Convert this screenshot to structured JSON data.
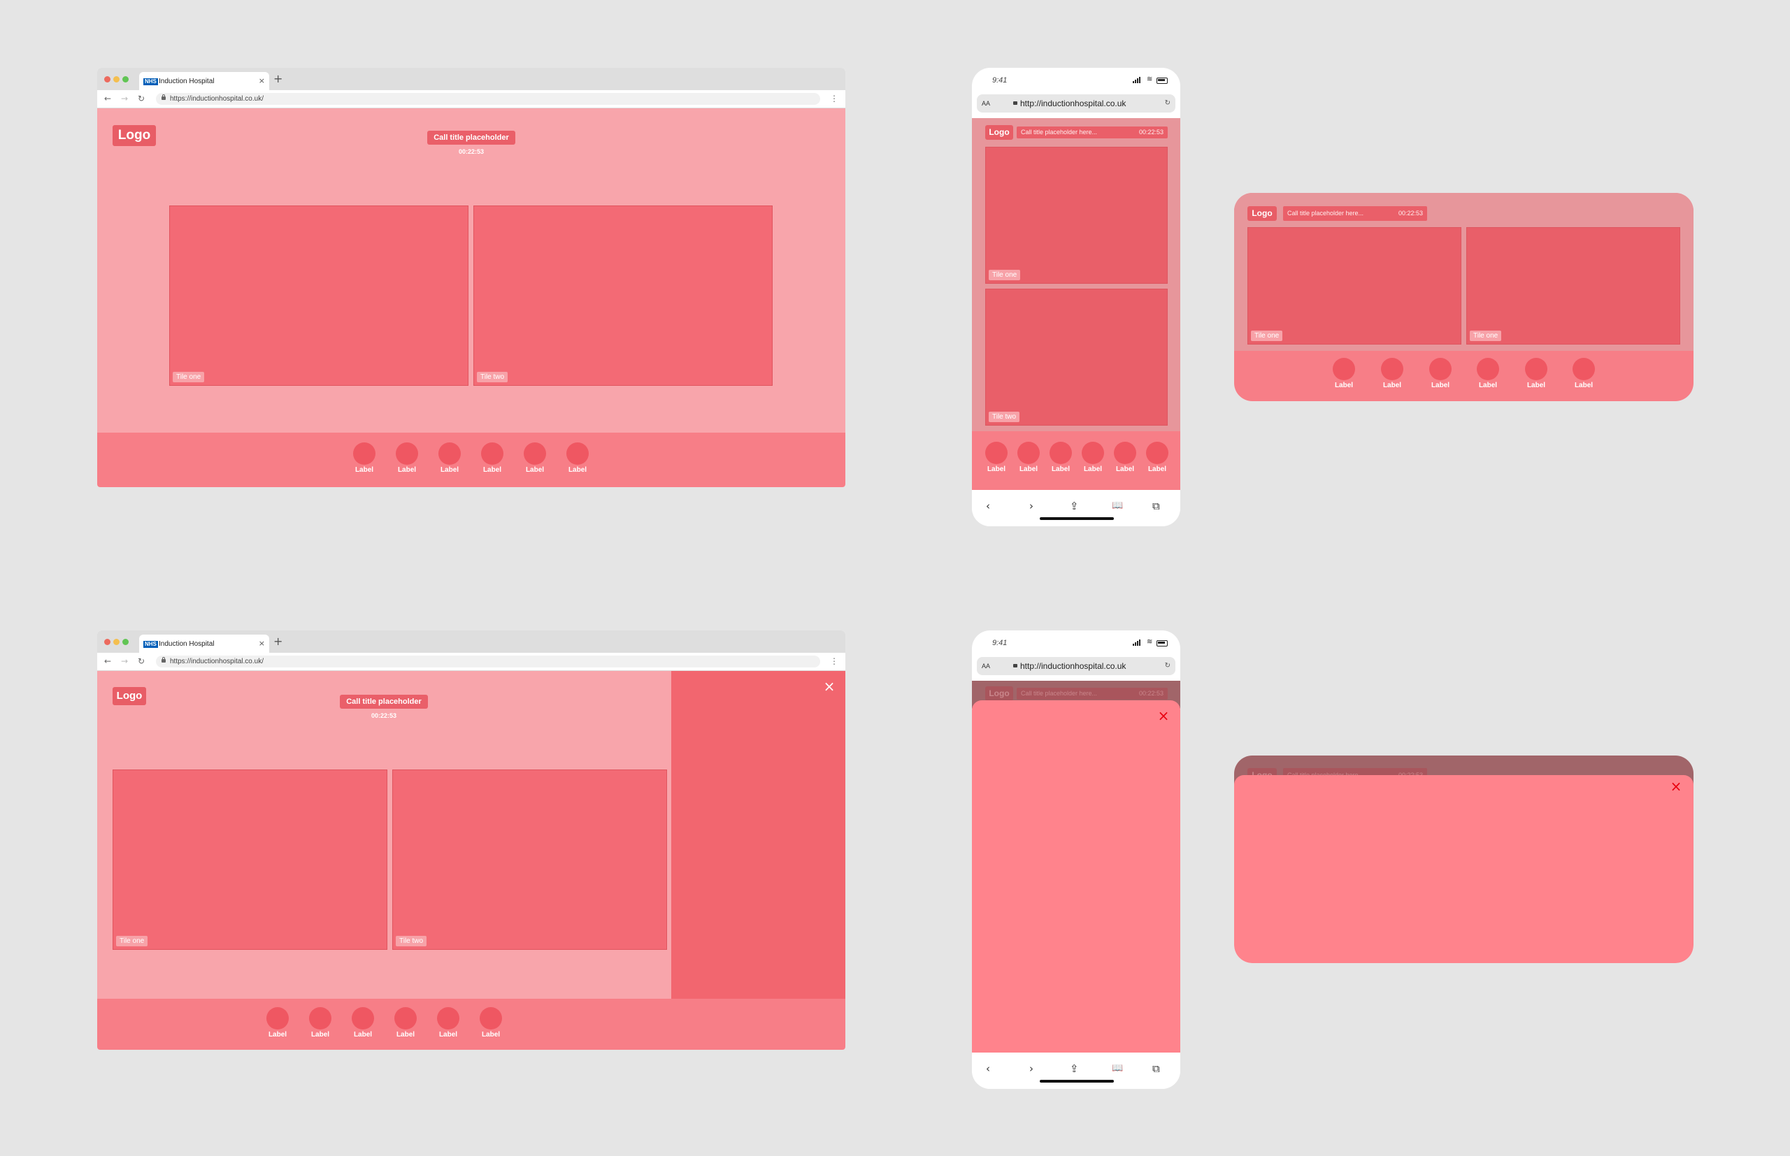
{
  "browser": {
    "tab_title": "Induction Hospital",
    "nhs_badge": "NHS",
    "tab_close": "×",
    "new_tab": "+",
    "url": "https://inductionhospital.co.uk/",
    "back": "←",
    "forward": "→",
    "reload": "↻",
    "menu": "⋮"
  },
  "call": {
    "logo": "Logo",
    "title": "Call title placeholder",
    "title_short": "Call title placeholder here...",
    "timer": "00:22:53",
    "tile_one": "Tile one",
    "tile_two": "Tile two"
  },
  "controls": {
    "labels": [
      "Label",
      "Label",
      "Label",
      "Label",
      "Label",
      "Label"
    ]
  },
  "phone": {
    "time": "9:41",
    "text_size": "AA",
    "url": "http://inductionhospital.co.uk",
    "reload": "↻",
    "nav": [
      "‹",
      "›",
      "⇪",
      "📖",
      "⧉"
    ]
  },
  "icons": {
    "close": "×",
    "wifi": "≋"
  },
  "colors": {
    "background": "#e5e5e5",
    "content": "#f8a5ab",
    "footer": "#f77e87",
    "tile": "#f36a75",
    "control": "#ef5762",
    "side_panel": "#f2666f",
    "sheet": "#ff838c"
  }
}
